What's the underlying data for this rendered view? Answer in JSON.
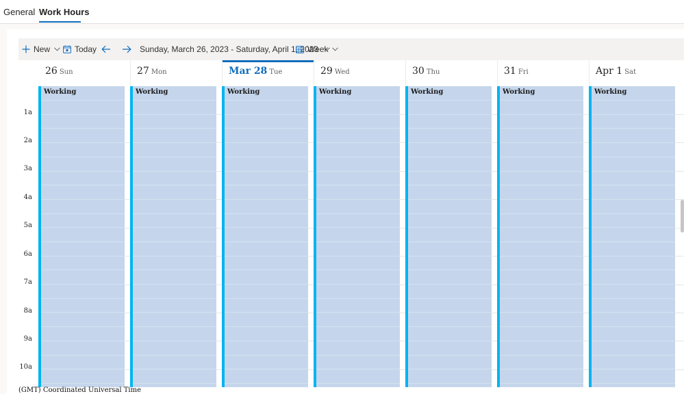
{
  "tabs": [
    {
      "label": "General",
      "active": false
    },
    {
      "label": "Work Hours",
      "active": true
    }
  ],
  "toolbar": {
    "new_label": "New",
    "today_label": "Today",
    "date_range": "Sunday, March 26, 2023 - Saturday, April 1, 2023",
    "view_label": "Week",
    "icons": {
      "new": "plus-icon",
      "new_chevron": "chevron-down-icon",
      "today": "calendar-today-icon",
      "prev": "arrow-left-icon",
      "next": "arrow-right-icon",
      "range_chevron": "chevron-down-icon",
      "view": "calendar-grid-icon",
      "view_chevron": "chevron-down-icon"
    }
  },
  "days": [
    {
      "num": "26",
      "name": "Sun",
      "today": false
    },
    {
      "num": "27",
      "name": "Mon",
      "today": false
    },
    {
      "num": "Mar 28",
      "name": "Tue",
      "today": true
    },
    {
      "num": "29",
      "name": "Wed",
      "today": false
    },
    {
      "num": "30",
      "name": "Thu",
      "today": false
    },
    {
      "num": "31",
      "name": "Fri",
      "today": false
    },
    {
      "num": "Apr 1",
      "name": "Sat",
      "today": false
    }
  ],
  "hours": [
    "1a",
    "2a",
    "3a",
    "4a",
    "5a",
    "6a",
    "7a",
    "8a",
    "9a",
    "10a"
  ],
  "event_label": "Working",
  "timezone": "(GMT) Coordinated Universal Time",
  "colors": {
    "accent": "#0f6cbd",
    "event_fill": "#c5d6ec",
    "event_bar": "#00b4f0"
  }
}
